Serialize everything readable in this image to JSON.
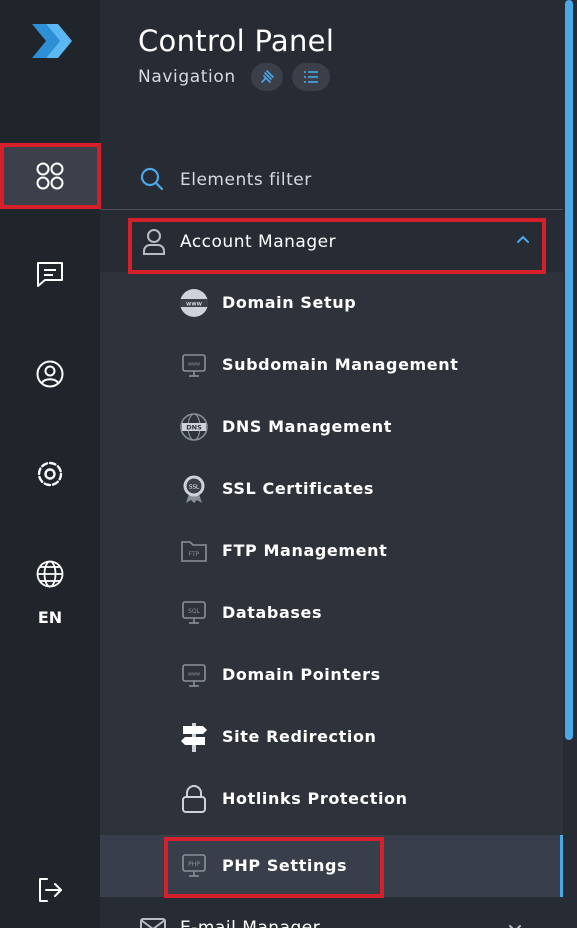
{
  "header": {
    "title": "Control Panel",
    "subtitle": "Navigation"
  },
  "rail": {
    "items": [
      {
        "name": "dashboard",
        "icon": "apps-grid-icon",
        "active": true
      },
      {
        "name": "messages",
        "icon": "chat-icon",
        "active": false
      },
      {
        "name": "profile",
        "icon": "user-circle-icon",
        "active": false
      },
      {
        "name": "settings",
        "icon": "gear-icon",
        "active": false
      },
      {
        "name": "language",
        "icon": "globe-icon",
        "active": false
      }
    ],
    "language": "EN",
    "logout_icon": "logout-icon"
  },
  "filter": {
    "placeholder": "Elements filter",
    "icon": "search-icon"
  },
  "account_manager": {
    "label": "Account Manager",
    "icon": "user-icon",
    "expanded": true,
    "items": [
      {
        "label": "Domain Setup",
        "icon": "www-globe-icon"
      },
      {
        "label": "Subdomain Management",
        "icon": "monitor-www-icon"
      },
      {
        "label": "DNS Management",
        "icon": "dns-globe-icon"
      },
      {
        "label": "SSL Certificates",
        "icon": "ssl-badge-icon"
      },
      {
        "label": "FTP Management",
        "icon": "ftp-folder-icon"
      },
      {
        "label": "Databases",
        "icon": "sql-monitor-icon"
      },
      {
        "label": "Domain Pointers",
        "icon": "monitor-www-icon"
      },
      {
        "label": "Site Redirection",
        "icon": "signpost-icon"
      },
      {
        "label": "Hotlinks Protection",
        "icon": "lock-icon"
      },
      {
        "label": "PHP Settings",
        "icon": "php-monitor-icon",
        "active": true
      }
    ]
  },
  "email_manager": {
    "label": "E-mail Manager",
    "icon": "envelope-icon"
  },
  "colors": {
    "accent": "#4aa8e8",
    "highlight_border": "#d3202a",
    "rail_bg": "#20242b",
    "panel_bg": "#272b34",
    "submenu_bg": "#2e323b"
  }
}
